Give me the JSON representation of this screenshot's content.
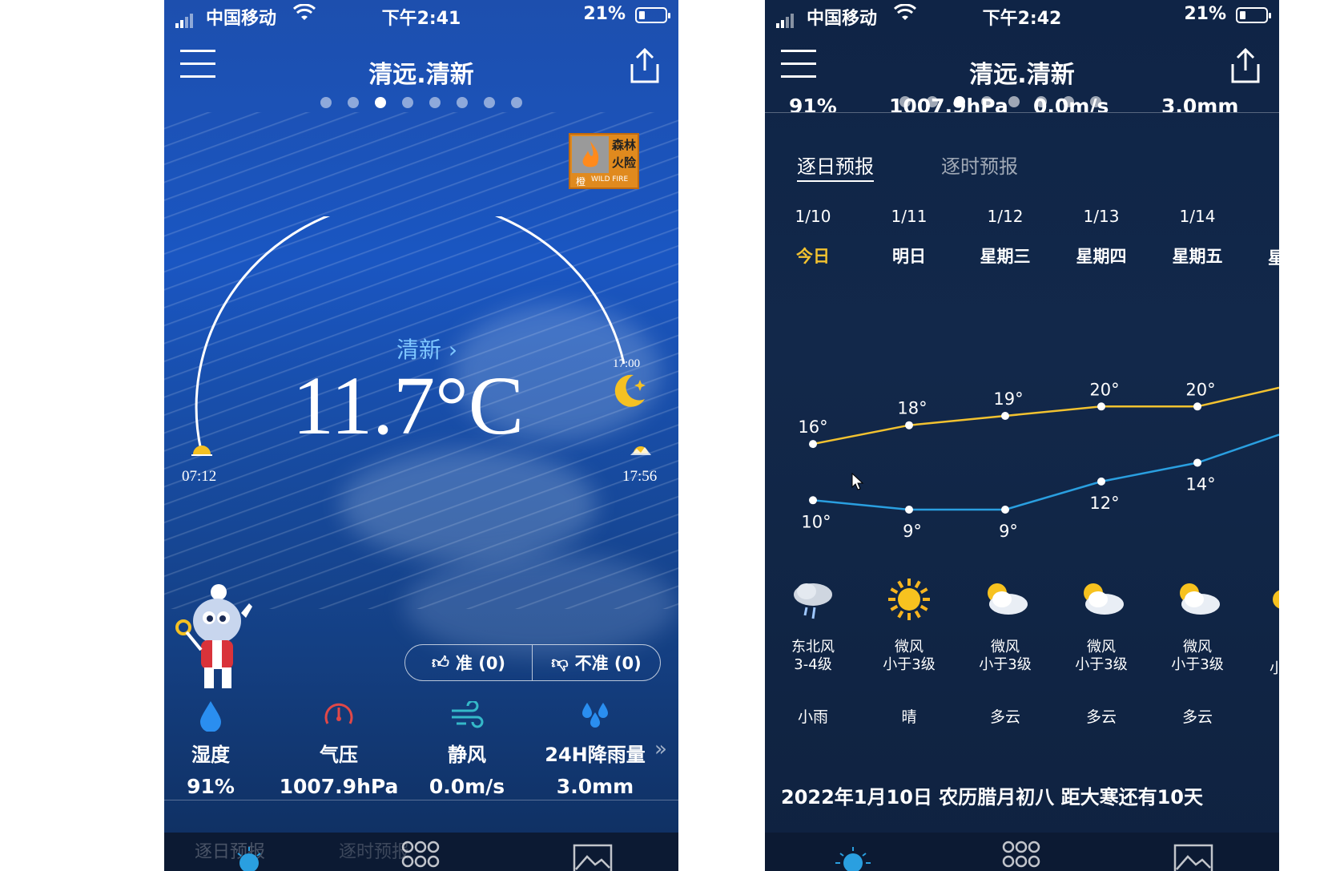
{
  "left": {
    "status": {
      "carrier": "中国移动",
      "time": "下午2:41",
      "battery": "21%"
    },
    "header": {
      "title": "清远.清新"
    },
    "page_dots": {
      "count": 8,
      "active": 2
    },
    "alert_badge": {
      "line1": "森林",
      "line2": "火险",
      "level": "橙",
      "en": "WILD FIRE"
    },
    "location_link": "清新",
    "temperature": "11.7°C",
    "sun": {
      "sunrise": "07:12",
      "sunset": "17:56",
      "moon": "17:00"
    },
    "vote": {
      "up": "准 (0)",
      "down": "不准 (0)"
    },
    "metrics": [
      {
        "label": "湿度",
        "value": "91%",
        "icon": "droplet-icon"
      },
      {
        "label": "气压",
        "value": "1007.9hPa",
        "icon": "gauge-icon"
      },
      {
        "label": "静风",
        "value": "0.0m/s",
        "icon": "wind-icon"
      },
      {
        "label": "24H降雨量",
        "value": "3.0mm",
        "icon": "rain-drops-icon"
      }
    ],
    "bottom_tabs": [
      "逐日预报",
      "逐时预报"
    ]
  },
  "right": {
    "status": {
      "carrier": "中国移动",
      "time": "下午2:42",
      "battery": "21%"
    },
    "header": {
      "title": "清远.清新"
    },
    "scrolled_values": [
      "91%",
      "1007.9hPa",
      "0.0m/s",
      "3.0mm"
    ],
    "tabs": [
      "逐日预报",
      "逐时预报"
    ],
    "days": [
      {
        "date": "1/10",
        "weekday": "今日",
        "high": "16°",
        "low": "10°",
        "wind_dir": "东北风",
        "wind_lvl": "3-4级",
        "cond": "小雨",
        "icon": "rain-cloud-icon"
      },
      {
        "date": "1/11",
        "weekday": "明日",
        "high": "18°",
        "low": "9°",
        "wind_dir": "微风",
        "wind_lvl": "小于3级",
        "cond": "晴",
        "icon": "sun-icon"
      },
      {
        "date": "1/12",
        "weekday": "星期三",
        "high": "19°",
        "low": "9°",
        "wind_dir": "微风",
        "wind_lvl": "小于3级",
        "cond": "多云",
        "icon": "partly-cloudy-icon"
      },
      {
        "date": "1/13",
        "weekday": "星期四",
        "high": "20°",
        "low": "12°",
        "wind_dir": "微风",
        "wind_lvl": "小于3级",
        "cond": "多云",
        "icon": "partly-cloudy-icon"
      },
      {
        "date": "1/14",
        "weekday": "星期五",
        "high": "20°",
        "low": "14°",
        "wind_dir": "微风",
        "wind_lvl": "小于3级",
        "cond": "多云",
        "icon": "partly-cloudy-icon"
      }
    ],
    "partial_next": {
      "weekday_char": "星",
      "wind_char": "小"
    },
    "footer": "2022年1月10日  农历腊月初八  距大寒还有10天",
    "colors": {
      "high_line": "#f2c230",
      "low_line": "#2a9fe0",
      "today": "#f2c230"
    }
  }
}
